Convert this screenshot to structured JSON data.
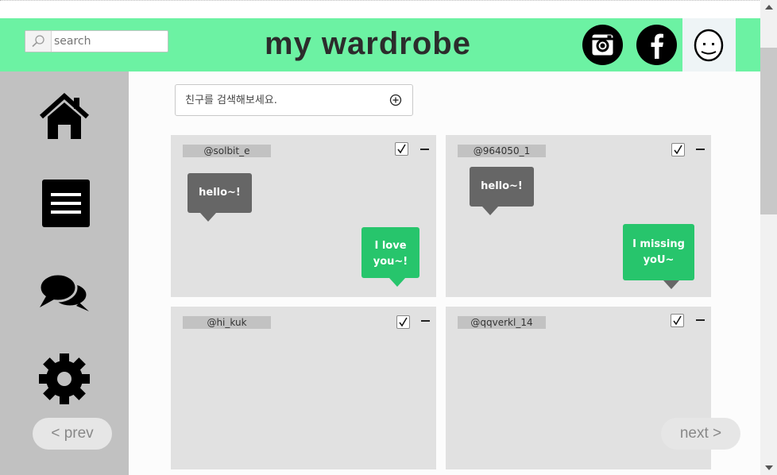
{
  "header": {
    "search_placeholder": "search",
    "title": "my wardrobe"
  },
  "sidebar": {
    "items": [
      {
        "name": "home-icon"
      },
      {
        "name": "menu-icon"
      },
      {
        "name": "chat-icon"
      },
      {
        "name": "gear-icon"
      }
    ]
  },
  "pager": {
    "prev": "< prev",
    "next": "next >"
  },
  "friend_search": {
    "placeholder": "친구를 검색해보세요."
  },
  "cards": [
    {
      "handle": "@solbit_e",
      "checked": true,
      "bubbles": [
        {
          "from": "other",
          "text": "hello~!"
        },
        {
          "from": "me",
          "text": "I love you~!"
        }
      ]
    },
    {
      "handle": "@964050_1",
      "checked": true,
      "bubbles": [
        {
          "from": "other",
          "text": "hello~!"
        },
        {
          "from": "me",
          "text": "I  missing yoU~"
        }
      ]
    },
    {
      "handle": "@hi_kuk",
      "checked": true,
      "bubbles": []
    },
    {
      "handle": "@qqverkl_14",
      "checked": true,
      "bubbles": []
    }
  ],
  "colors": {
    "header": "#6cf2a3",
    "sidebar": "#c1c1c1",
    "card": "#e1e1e1",
    "bubble_other": "#666666",
    "bubble_me": "#27c56c"
  }
}
